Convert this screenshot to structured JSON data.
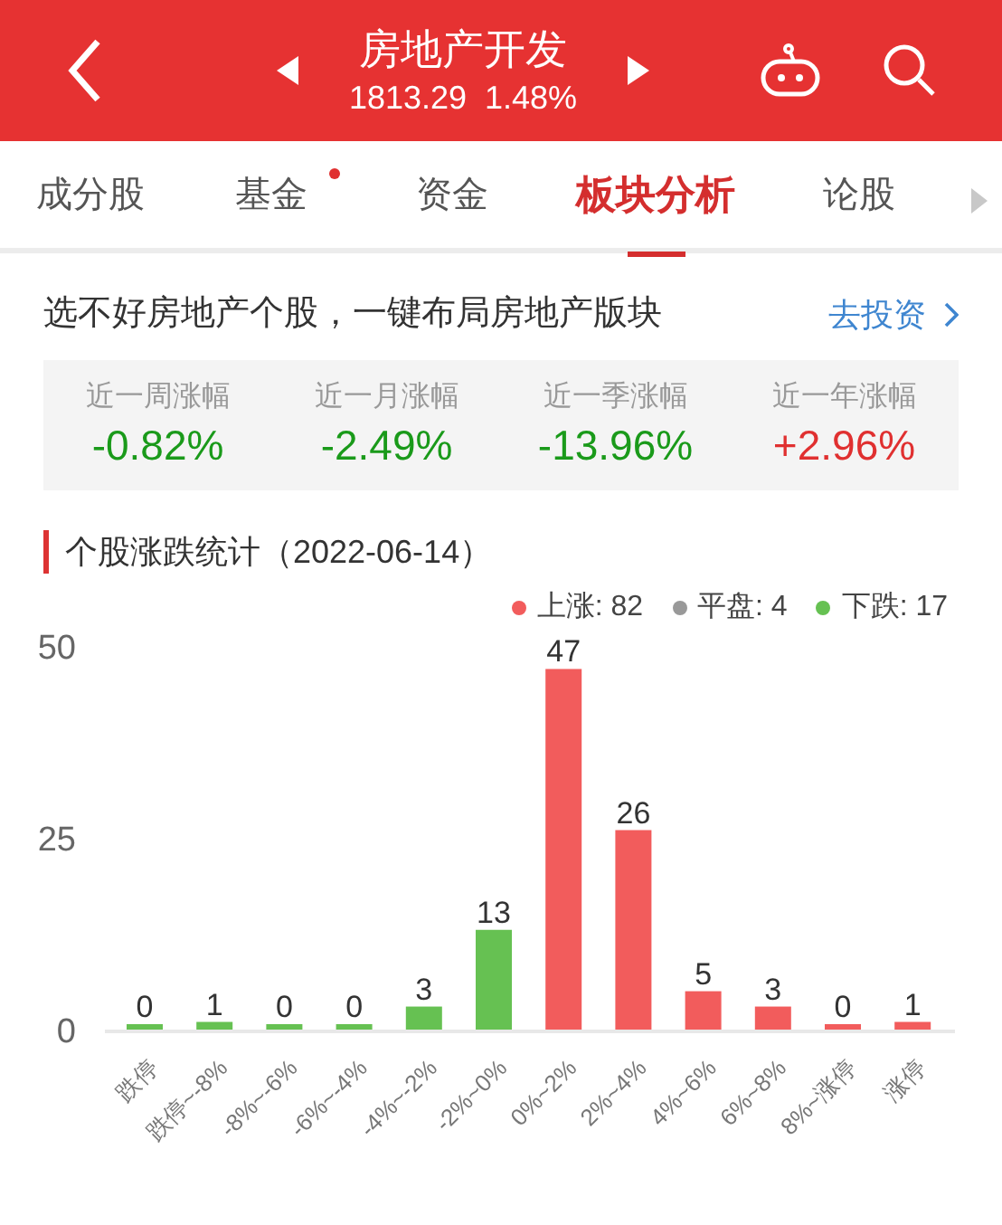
{
  "header": {
    "title": "房地产开发",
    "price": "1813.29",
    "change": "1.48%"
  },
  "tabs": [
    {
      "label": "成分股",
      "selected": false,
      "dot": false
    },
    {
      "label": "基金",
      "selected": false,
      "dot": true
    },
    {
      "label": "资金",
      "selected": false,
      "dot": false
    },
    {
      "label": "板块分析",
      "selected": true,
      "dot": false
    },
    {
      "label": "论股",
      "selected": false,
      "dot": false
    }
  ],
  "banner": {
    "text": "选不好房地产个股，一键布局房地产版块",
    "link": "去投资"
  },
  "stats": [
    {
      "label": "近一周涨幅",
      "value": "-0.82%",
      "color": "#1a9a1a"
    },
    {
      "label": "近一月涨幅",
      "value": "-2.49%",
      "color": "#1a9a1a"
    },
    {
      "label": "近一季涨幅",
      "value": "-13.96%",
      "color": "#1a9a1a"
    },
    {
      "label": "近一年涨幅",
      "value": "+2.96%",
      "color": "#e03030"
    }
  ],
  "section_title": "个股涨跌统计（2022-06-14）",
  "legend": [
    {
      "label": "上涨: 82",
      "color": "#f25c5c"
    },
    {
      "label": "平盘: 4",
      "color": "#999999"
    },
    {
      "label": "下跌: 17",
      "color": "#66c152"
    }
  ],
  "chart_data": {
    "type": "bar",
    "data_labels": true,
    "yticks": [
      0,
      25,
      50
    ],
    "ylim": [
      0,
      50
    ],
    "categories": [
      "跌停",
      "跌停~-8%",
      "-8%~-6%",
      "-6%~-4%",
      "-4%~-2%",
      "-2%~0%",
      "0%~2%",
      "2%~4%",
      "4%~6%",
      "6%~8%",
      "8%~涨停",
      "涨停"
    ],
    "series": [
      {
        "color": "#66c152",
        "values": [
          0,
          1,
          0,
          0,
          3,
          13,
          null,
          null,
          null,
          null,
          null,
          null
        ]
      },
      {
        "color": "#f25c5c",
        "values": [
          null,
          null,
          null,
          null,
          null,
          null,
          47,
          26,
          5,
          3,
          0,
          1
        ]
      }
    ]
  }
}
